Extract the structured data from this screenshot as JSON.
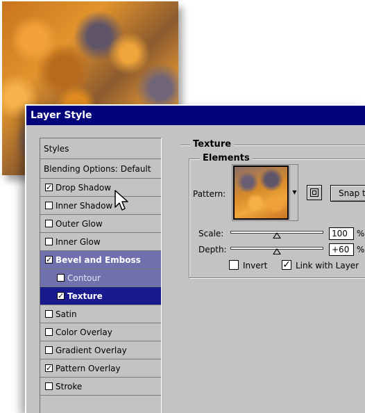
{
  "dialog": {
    "title": "Layer Style"
  },
  "styles_list": {
    "header": "Styles",
    "blending": "Blending Options: Default",
    "items": [
      {
        "label": "Drop Shadow",
        "checked": true
      },
      {
        "label": "Inner Shadow",
        "checked": false
      },
      {
        "label": "Outer Glow",
        "checked": false
      },
      {
        "label": "Inner Glow",
        "checked": false
      },
      {
        "label": "Bevel and Emboss",
        "checked": true
      },
      {
        "label": "Contour",
        "checked": false
      },
      {
        "label": "Texture",
        "checked": true
      },
      {
        "label": "Satin",
        "checked": false
      },
      {
        "label": "Color Overlay",
        "checked": false
      },
      {
        "label": "Gradient Overlay",
        "checked": false
      },
      {
        "label": "Pattern Overlay",
        "checked": true
      },
      {
        "label": "Stroke",
        "checked": false
      }
    ]
  },
  "texture": {
    "section_title": "Texture",
    "group_title": "Elements",
    "pattern_label": "Pattern:",
    "snap_label": "Snap to",
    "scale": {
      "label": "Scale:",
      "value": "100",
      "unit": "%",
      "level": 100
    },
    "depth": {
      "label": "Depth:",
      "value": "+60",
      "unit": "%",
      "level": 60
    },
    "invert": {
      "label": "Invert",
      "checked": false
    },
    "link": {
      "label": "Link with Layer",
      "checked": true
    }
  },
  "check_glyph": "✓"
}
